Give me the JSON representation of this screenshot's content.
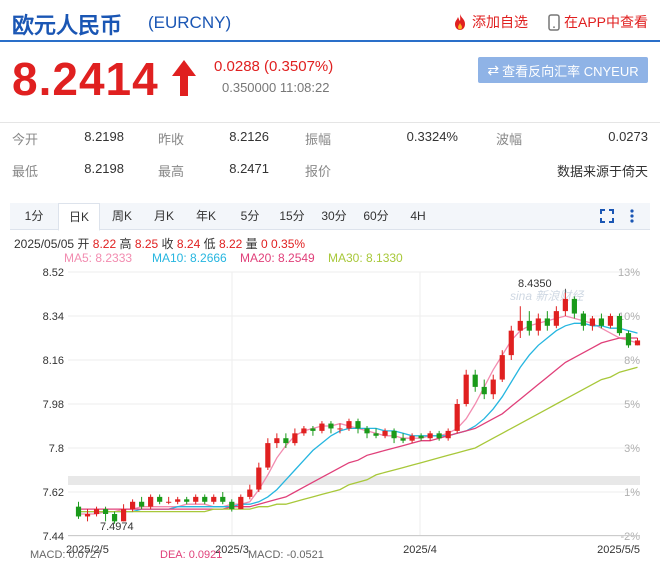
{
  "header": {
    "title": "欧元人民币",
    "code": "(EURCNY)",
    "add_watch": "添加自选",
    "app_view": "在APP中查看"
  },
  "quote": {
    "price": "8.2414",
    "arrow": "↑",
    "change": "0.0288 (0.3507%)",
    "sub": "0.350000 11:08:22",
    "reverse_btn": "查看反向汇率 CNYEUR"
  },
  "stats": {
    "row1": [
      {
        "label": "今开",
        "value": "8.2198"
      },
      {
        "label": "昨收",
        "value": "8.2126"
      },
      {
        "label": "振幅",
        "value": "0.3324%"
      },
      {
        "label": "波幅",
        "value": "0.0273"
      }
    ],
    "row2": [
      {
        "label": "最低",
        "value": "8.2198"
      },
      {
        "label": "最高",
        "value": "8.2471"
      },
      {
        "label": "报价",
        "value": ""
      },
      {
        "label": "",
        "value": "数据来源于倚天"
      }
    ]
  },
  "tabs": [
    "1分",
    "日K",
    "周K",
    "月K",
    "年K",
    "5分",
    "15分",
    "30分",
    "60分",
    "4H"
  ],
  "active_tab": "日K",
  "ohlc": {
    "date": "2025/05/05",
    "open_label": "开",
    "open": "8.22",
    "high_label": "高",
    "high": "8.25",
    "close_label": "收",
    "close": "8.24",
    "low_label": "低",
    "low": "8.22",
    "vol_label": "量",
    "vol": "0",
    "pct": "0.35%"
  },
  "ma": {
    "ma5": "MA5: 8.2333",
    "ma10": "MA10: 8.2666",
    "ma20": "MA20: 8.2549",
    "ma30": "MA30: 8.1330"
  },
  "colors": {
    "up": "#e02020",
    "down": "#1a9a1a",
    "ma5": "#f28cb0",
    "ma10": "#26b6e0",
    "ma20": "#e0407a",
    "ma30": "#a8c83a",
    "brand_blue": "#1a56b4"
  },
  "chart_data": {
    "type": "candlestick",
    "y_ticks": [
      "8.52",
      "8.34",
      "8.16",
      "7.98",
      "7.8",
      "7.62",
      "7.44"
    ],
    "pct_ticks": [
      "13%",
      "10%",
      "8%",
      "5%",
      "3%",
      "1%",
      "-2%"
    ],
    "x_ticks": [
      "2025/2/5",
      "2025/3",
      "2025/4",
      "2025/5/5"
    ],
    "ylim": [
      7.44,
      8.52
    ],
    "annotations": {
      "max": "8.4350",
      "min": "7.4974"
    },
    "watermark": "sina 新浪财经",
    "series": [
      {
        "name": "MA5",
        "values": [
          7.53,
          7.53,
          7.53,
          7.54,
          7.54,
          7.55,
          7.55,
          7.56,
          7.56,
          7.56,
          7.56,
          7.56,
          7.57,
          7.57,
          7.57,
          7.56,
          7.56,
          7.57,
          7.57,
          7.58,
          7.63,
          7.69,
          7.76,
          7.81,
          7.85,
          7.87,
          7.88,
          7.89,
          7.89,
          7.9,
          7.89,
          7.88,
          7.87,
          7.86,
          7.85,
          7.85,
          7.84,
          7.84,
          7.84,
          7.85,
          7.85,
          7.86,
          7.88,
          7.92,
          7.98,
          8.05,
          8.12,
          8.18,
          8.24,
          8.28,
          8.3,
          8.31,
          8.32,
          8.33,
          8.34,
          8.33,
          8.32,
          8.31,
          8.29,
          8.27,
          8.25,
          8.24,
          8.23
        ]
      },
      {
        "name": "MA10",
        "values": [
          7.54,
          7.54,
          7.54,
          7.54,
          7.54,
          7.54,
          7.54,
          7.55,
          7.55,
          7.55,
          7.55,
          7.56,
          7.56,
          7.56,
          7.56,
          7.56,
          7.56,
          7.56,
          7.57,
          7.57,
          7.58,
          7.6,
          7.63,
          7.67,
          7.71,
          7.75,
          7.79,
          7.82,
          7.85,
          7.87,
          7.88,
          7.88,
          7.88,
          7.88,
          7.87,
          7.87,
          7.86,
          7.85,
          7.85,
          7.85,
          7.85,
          7.85,
          7.86,
          7.87,
          7.89,
          7.92,
          7.96,
          8.01,
          8.07,
          8.13,
          8.18,
          8.22,
          8.25,
          8.28,
          8.3,
          8.31,
          8.31,
          8.3,
          8.3,
          8.29,
          8.29,
          8.28,
          8.27
        ]
      },
      {
        "name": "MA20",
        "values": [
          7.55,
          7.55,
          7.55,
          7.55,
          7.55,
          7.55,
          7.55,
          7.55,
          7.55,
          7.55,
          7.55,
          7.55,
          7.55,
          7.55,
          7.55,
          7.55,
          7.55,
          7.56,
          7.56,
          7.56,
          7.57,
          7.58,
          7.59,
          7.6,
          7.62,
          7.64,
          7.66,
          7.68,
          7.7,
          7.72,
          7.74,
          7.75,
          7.77,
          7.78,
          7.79,
          7.8,
          7.81,
          7.82,
          7.83,
          7.83,
          7.84,
          7.85,
          7.86,
          7.87,
          7.88,
          7.9,
          7.92,
          7.94,
          7.97,
          8.0,
          8.03,
          8.06,
          8.09,
          8.12,
          8.15,
          8.17,
          8.19,
          8.21,
          8.23,
          8.24,
          8.25,
          8.25,
          8.25
        ]
      },
      {
        "name": "MA30",
        "values": [
          7.54,
          7.54,
          7.54,
          7.54,
          7.54,
          7.54,
          7.54,
          7.54,
          7.54,
          7.54,
          7.54,
          7.54,
          7.54,
          7.54,
          7.54,
          7.55,
          7.55,
          7.55,
          7.55,
          7.55,
          7.56,
          7.56,
          7.57,
          7.57,
          7.58,
          7.59,
          7.6,
          7.61,
          7.62,
          7.63,
          7.65,
          7.66,
          7.67,
          7.69,
          7.7,
          7.71,
          7.72,
          7.73,
          7.74,
          7.75,
          7.76,
          7.77,
          7.78,
          7.79,
          7.8,
          7.82,
          7.84,
          7.86,
          7.88,
          7.9,
          7.92,
          7.94,
          7.96,
          7.98,
          8.0,
          8.02,
          8.04,
          8.06,
          8.08,
          8.09,
          8.11,
          8.12,
          8.13
        ]
      }
    ],
    "candles": [
      [
        7.56,
        7.52,
        7.58,
        7.51
      ],
      [
        7.52,
        7.53,
        7.55,
        7.5
      ],
      [
        7.53,
        7.55,
        7.56,
        7.52
      ],
      [
        7.55,
        7.53,
        7.56,
        7.5
      ],
      [
        7.53,
        7.5,
        7.54,
        7.49
      ],
      [
        7.5,
        7.55,
        7.57,
        7.5
      ],
      [
        7.55,
        7.58,
        7.59,
        7.54
      ],
      [
        7.58,
        7.56,
        7.6,
        7.55
      ],
      [
        7.56,
        7.6,
        7.61,
        7.55
      ],
      [
        7.6,
        7.58,
        7.61,
        7.57
      ],
      [
        7.58,
        7.58,
        7.6,
        7.57
      ],
      [
        7.58,
        7.59,
        7.6,
        7.57
      ],
      [
        7.59,
        7.58,
        7.6,
        7.57
      ],
      [
        7.58,
        7.6,
        7.61,
        7.57
      ],
      [
        7.6,
        7.58,
        7.61,
        7.57
      ],
      [
        7.58,
        7.6,
        7.61,
        7.57
      ],
      [
        7.6,
        7.58,
        7.62,
        7.57
      ],
      [
        7.58,
        7.55,
        7.59,
        7.54
      ],
      [
        7.55,
        7.6,
        7.61,
        7.55
      ],
      [
        7.6,
        7.63,
        7.65,
        7.59
      ],
      [
        7.63,
        7.72,
        7.74,
        7.62
      ],
      [
        7.72,
        7.82,
        7.84,
        7.71
      ],
      [
        7.82,
        7.84,
        7.86,
        7.8
      ],
      [
        7.84,
        7.82,
        7.86,
        7.8
      ],
      [
        7.82,
        7.86,
        7.88,
        7.81
      ],
      [
        7.86,
        7.88,
        7.89,
        7.85
      ],
      [
        7.88,
        7.87,
        7.89,
        7.85
      ],
      [
        7.87,
        7.9,
        7.91,
        7.86
      ],
      [
        7.9,
        7.88,
        7.91,
        7.86
      ],
      [
        7.88,
        7.88,
        7.9,
        7.86
      ],
      [
        7.88,
        7.91,
        7.92,
        7.87
      ],
      [
        7.91,
        7.88,
        7.92,
        7.86
      ],
      [
        7.88,
        7.86,
        7.89,
        7.84
      ],
      [
        7.86,
        7.85,
        7.88,
        7.84
      ],
      [
        7.85,
        7.87,
        7.88,
        7.84
      ],
      [
        7.87,
        7.84,
        7.88,
        7.82
      ],
      [
        7.84,
        7.83,
        7.86,
        7.82
      ],
      [
        7.83,
        7.85,
        7.86,
        7.82
      ],
      [
        7.85,
        7.84,
        7.86,
        7.83
      ],
      [
        7.84,
        7.86,
        7.87,
        7.83
      ],
      [
        7.86,
        7.84,
        7.87,
        7.83
      ],
      [
        7.84,
        7.87,
        7.88,
        7.83
      ],
      [
        7.87,
        7.98,
        8.0,
        7.86
      ],
      [
        7.98,
        8.1,
        8.12,
        7.97
      ],
      [
        8.1,
        8.05,
        8.12,
        8.03
      ],
      [
        8.05,
        8.02,
        8.08,
        8.0
      ],
      [
        8.02,
        8.08,
        8.1,
        8.0
      ],
      [
        8.08,
        8.18,
        8.2,
        8.07
      ],
      [
        8.18,
        8.28,
        8.3,
        8.16
      ],
      [
        8.28,
        8.32,
        8.38,
        8.25
      ],
      [
        8.32,
        8.28,
        8.36,
        8.26
      ],
      [
        8.28,
        8.33,
        8.35,
        8.26
      ],
      [
        8.33,
        8.3,
        8.36,
        8.28
      ],
      [
        8.3,
        8.36,
        8.38,
        8.29
      ],
      [
        8.36,
        8.41,
        8.435,
        8.34
      ],
      [
        8.41,
        8.35,
        8.42,
        8.33
      ],
      [
        8.35,
        8.3,
        8.36,
        8.28
      ],
      [
        8.3,
        8.33,
        8.34,
        8.28
      ],
      [
        8.33,
        8.3,
        8.35,
        8.29
      ],
      [
        8.3,
        8.34,
        8.35,
        8.29
      ],
      [
        8.34,
        8.27,
        8.35,
        8.26
      ],
      [
        8.27,
        8.22,
        8.28,
        8.21
      ],
      [
        8.22,
        8.24,
        8.25,
        8.22
      ]
    ]
  },
  "footer": {
    "macd": "MACD: 0.0727",
    "dea": "DEA: 0.0921",
    "macd2": "MACD: -0.0521"
  }
}
